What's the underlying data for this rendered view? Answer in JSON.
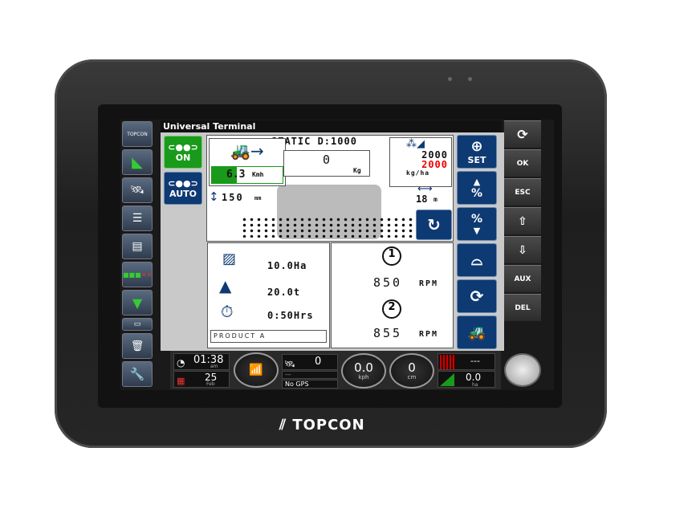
{
  "brand": "TOPCON",
  "title": "Universal Terminal",
  "sidebar": [
    {
      "icon": "topcon-logo-icon",
      "label": "TOPCON"
    },
    {
      "icon": "guidance-arrow-icon"
    },
    {
      "icon": "satellite-icon"
    },
    {
      "icon": "settings-bars-icon"
    },
    {
      "icon": "console-icon"
    },
    {
      "icon": "section-control-icon"
    },
    {
      "icon": "spreader-icon"
    },
    {
      "icon": "implement-icon"
    },
    {
      "icon": "data-transfer-icon"
    },
    {
      "icon": "wrench-icon"
    }
  ],
  "section_buttons": {
    "on": "ON",
    "auto": "AUTO"
  },
  "main": {
    "static": "STATIC D:1000",
    "speed": "6.3",
    "speed_unit": "Kmh",
    "speed_fill": 0.35,
    "weight": "0",
    "weight_unit": "Kg",
    "target_rate": "2000",
    "actual_rate": "2000",
    "rate_unit": "kg/ha",
    "height": "150",
    "height_unit": "mm",
    "width": "18",
    "width_unit": "m",
    "area": "10.0Ha",
    "mass": "20.0t",
    "time": "0:50Hrs",
    "product": "PRODUCT A",
    "disc1_label": "1",
    "disc1_rpm": "850",
    "disc2_label": "2",
    "disc2_rpm": "855",
    "rpm_unit": "RPM"
  },
  "soft_keys": [
    {
      "icon": "crosshair-icon",
      "label": "SET"
    },
    {
      "icon": "increase-percent-icon",
      "label": "%"
    },
    {
      "icon": "decrease-percent-icon",
      "label": "%"
    },
    {
      "icon": "spreader-disc-icon"
    },
    {
      "icon": "cycle-icon"
    },
    {
      "icon": "tractor-icon"
    }
  ],
  "hard_keys": [
    "",
    "OK",
    "ESC",
    "⇧",
    "⇩",
    "AUX",
    "DEL"
  ],
  "status": {
    "time": "01:38",
    "ampm": "am",
    "day": "25",
    "month": "Feb",
    "sats": "0",
    "gps_dash": "---",
    "gps": "No GPS",
    "speed": "0.0",
    "speed_unit": "kph",
    "offset": "0",
    "offset_unit": "cm",
    "tramline": "---",
    "area": "0.0",
    "area_unit": "ha"
  },
  "colors": {
    "green": "#1a9a1a",
    "navy": "#0e3a73",
    "red": "#e00000"
  }
}
